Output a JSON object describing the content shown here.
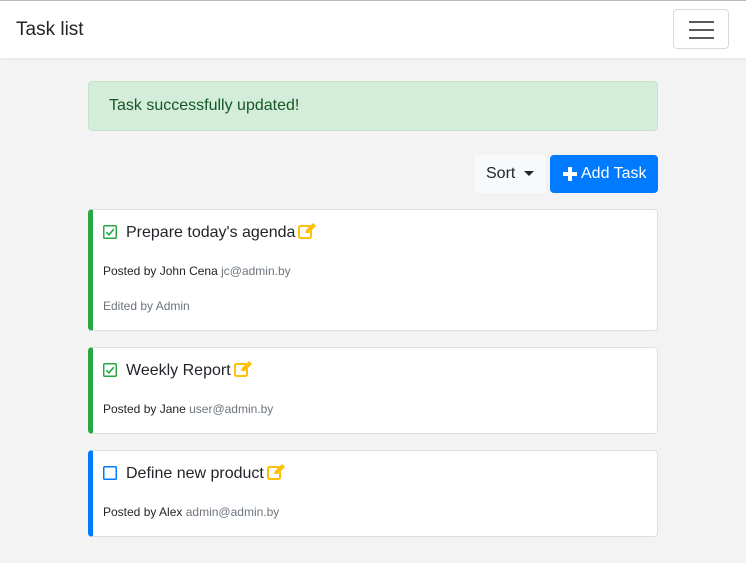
{
  "navbar": {
    "brand": "Task list",
    "toggler_icon": "hamburger-icon"
  },
  "alert": {
    "message": "Task successfully updated!",
    "color": "#155724",
    "background": "#d4edda"
  },
  "toolbar": {
    "sort_label": "Sort",
    "add_label": "Add Task",
    "add_icon": "plus-icon",
    "add_color": "#007bff"
  },
  "tasks": [
    {
      "title": "Prepare today's agenda",
      "done": true,
      "posted_prefix": "Posted by",
      "author": "John Cena",
      "email": "jc@admin.by",
      "edited": "Edited by Admin",
      "accent": "#28a745"
    },
    {
      "title": "Weekly Report",
      "done": true,
      "posted_prefix": "Posted by",
      "author": "Jane",
      "email": "user@admin.by",
      "accent": "#28a745"
    },
    {
      "title": "Define new product",
      "done": false,
      "posted_prefix": "Posted by",
      "author": "Alex",
      "email": "admin@admin.by",
      "accent": "#007bff"
    }
  ]
}
